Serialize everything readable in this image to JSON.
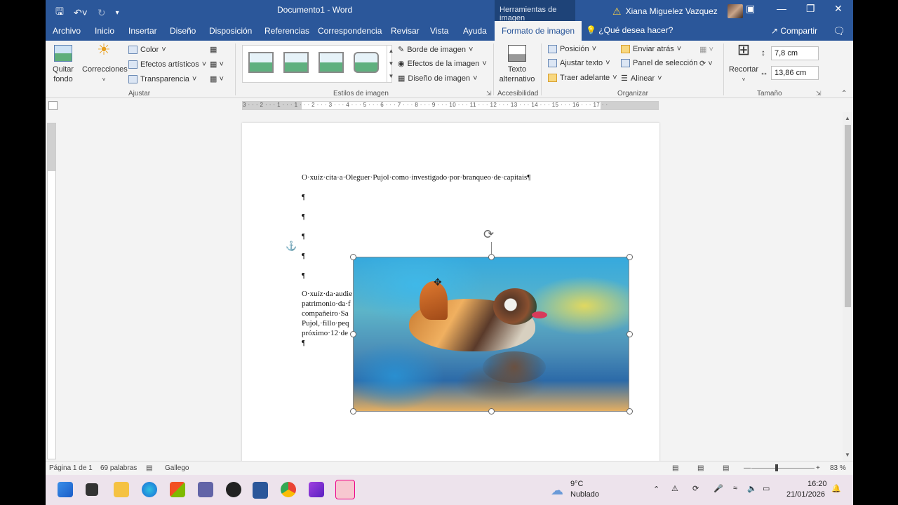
{
  "titlebar": {
    "doc_title": "Documento1  -  Word",
    "context_tab": "Herramientas de imagen",
    "user_name": "Xiana Miguelez Vazquez"
  },
  "tabs": [
    "Archivo",
    "Inicio",
    "Insertar",
    "Diseño",
    "Disposición",
    "Referencias",
    "Correspondencia",
    "Revisar",
    "Vista",
    "Ayuda",
    "Formato de imagen"
  ],
  "active_tab": "Formato de imagen",
  "tell_me": "¿Qué desea hacer?",
  "share": "Compartir",
  "ribbon": {
    "ajustar": {
      "quitar_fondo": "Quitar fondo",
      "correcciones": "Correcciones",
      "color": "Color",
      "efectos_artisticos": "Efectos artísticos",
      "transparencia": "Transparencia",
      "label": "Ajustar"
    },
    "estilos": {
      "borde": "Borde de imagen",
      "efectos": "Efectos de la imagen",
      "diseno": "Diseño de imagen",
      "label": "Estilos de imagen"
    },
    "accesibilidad": {
      "texto_alternativo": "Texto alternativo",
      "label": "Accesibilidad"
    },
    "organizar": {
      "posicion": "Posición",
      "ajustar_texto": "Ajustar texto",
      "traer_adelante": "Traer adelante",
      "enviar_atras": "Enviar atrás",
      "panel_seleccion": "Panel de selección",
      "alinear": "Alinear",
      "label": "Organizar"
    },
    "tamano": {
      "recortar": "Recortar",
      "alto": "7,8 cm",
      "ancho": "13,86 cm",
      "label": "Tamaño"
    }
  },
  "ruler_text": "3 · · · 2 · · · 1 · · · 1 · · · 2 · · · 3 · · · 4 · · · 5 · · · 6 · · · 7 · · · 8 · · · 9 · · · 10 · · · 11 · · · 12 · · · 13 · · · 14 · · · 15 · · · 16 · · · 17 · ·",
  "document": {
    "line1": "O·xuíz·cita·a·Oleguer·Pujol·como·investigado·por·branqueo·de·capitais¶",
    "pilcrow": "¶",
    "body": [
      "O·xuíz·da·audie",
      "patrimonio·da·f",
      "compañeiro·Sa",
      "Pujol,·fillo·peq",
      "próximo·12·de"
    ]
  },
  "status": {
    "page": "Página 1 de 1",
    "words": "69 palabras",
    "language": "Gallego",
    "zoom": "83 %"
  },
  "taskbar": {
    "temp": "9°C",
    "weather": "Nublado",
    "time": "16:20",
    "date": "21/01/2026"
  }
}
